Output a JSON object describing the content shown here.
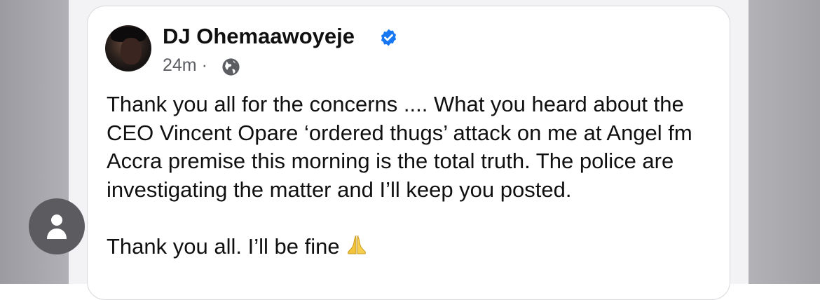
{
  "post": {
    "author": "DJ Ohemaawoyeje",
    "timestamp": "24m",
    "separator": "·",
    "paragraphs": [
      "Thank you all for the concerns .... What you heard about the CEO Vincent Opare ‘ordered thugs’ attack on me at Angel fm Accra premise this morning is the total truth. The police are investigating the matter and I’ll keep you posted.",
      "Thank you all. I’ll be fine"
    ],
    "icons": {
      "verified": "verified-badge-icon",
      "audience": "globe-icon",
      "emoji": "folded-hands-icon",
      "chat_head": "person-icon"
    }
  },
  "colors": {
    "verified": "#1877f2",
    "text": "#101010",
    "meta": "#5b5d62",
    "chat_head": "#5b5b60"
  }
}
